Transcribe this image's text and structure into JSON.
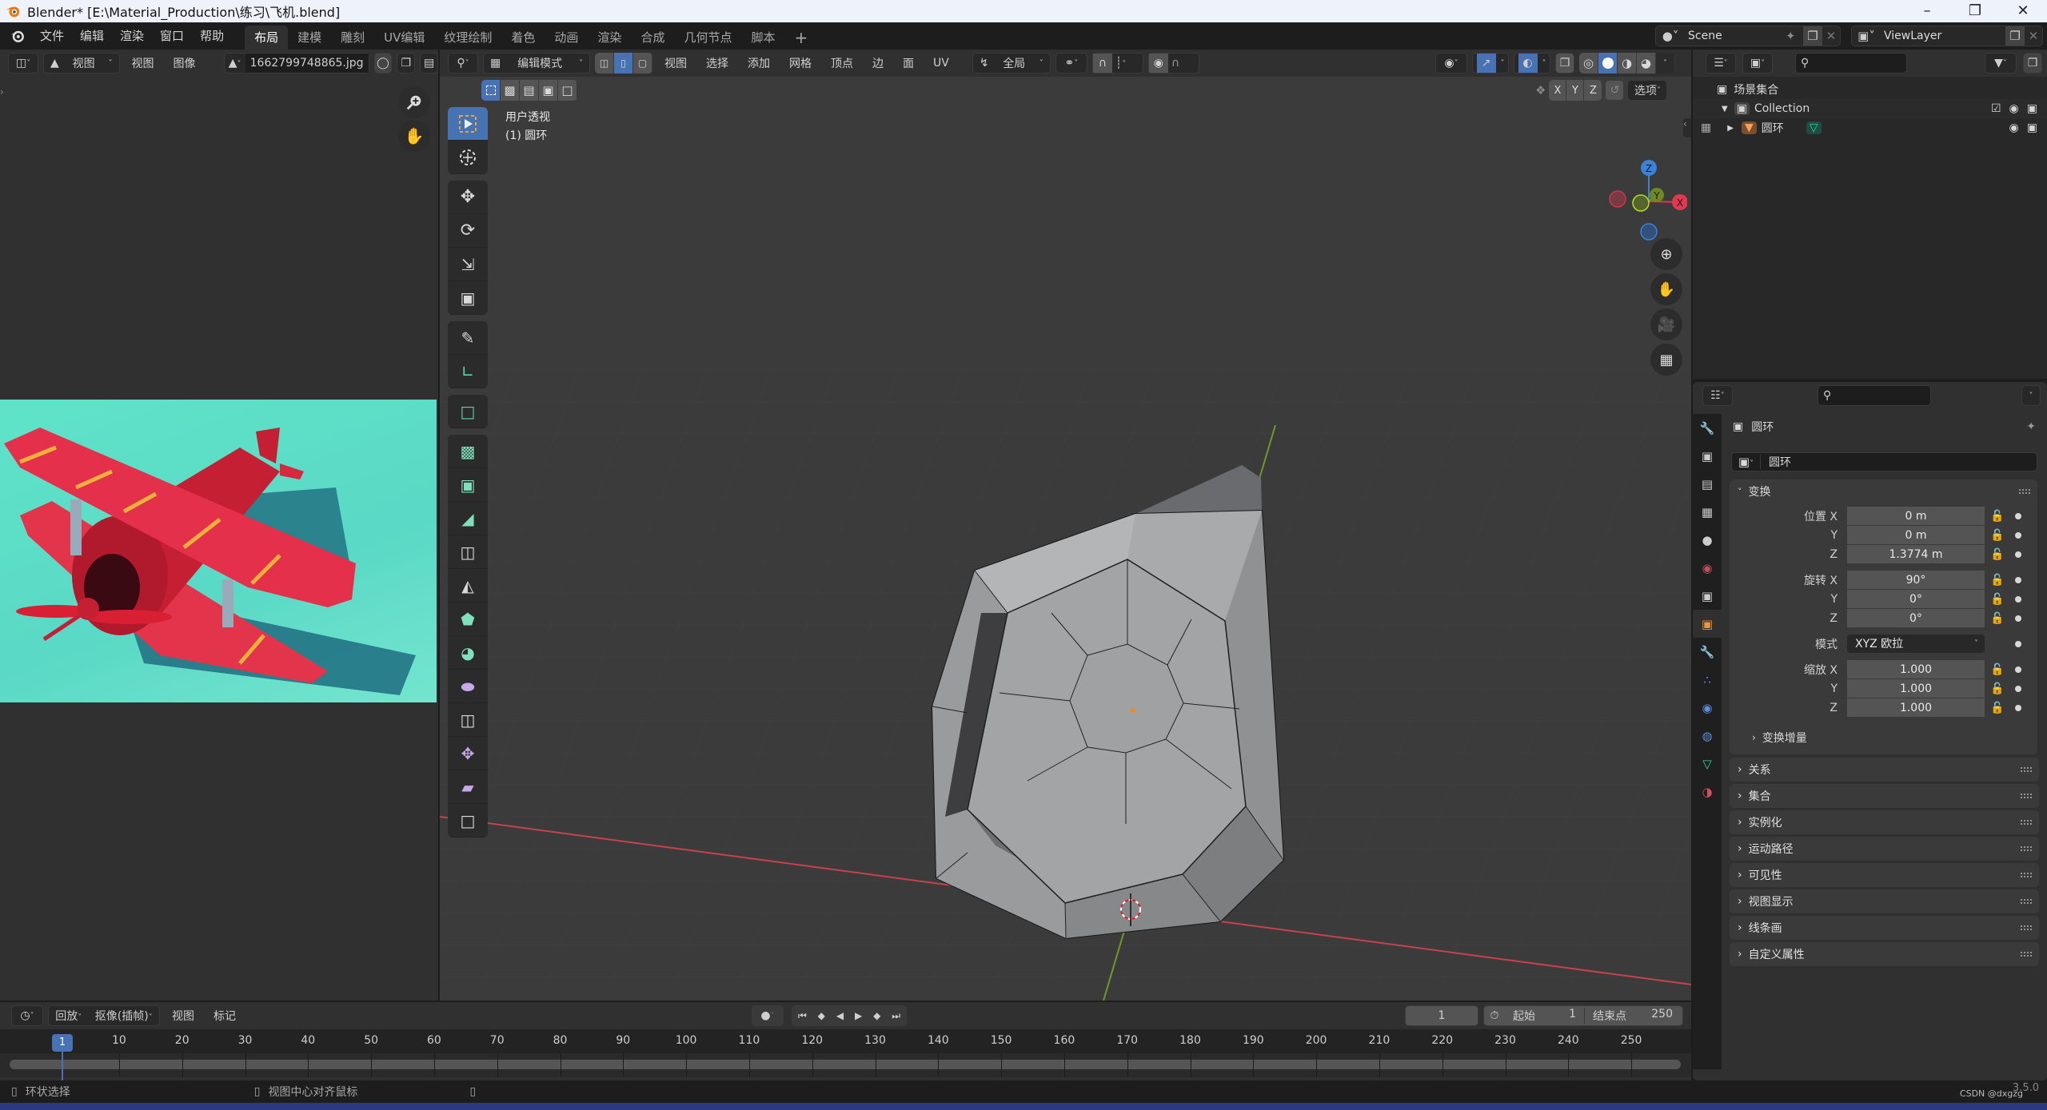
{
  "window": {
    "title": "Blender* [E:\\Material_Production\\练习\\飞机.blend]",
    "controls": [
      "minimize",
      "maximize",
      "close"
    ]
  },
  "top_menu": {
    "items": [
      "文件",
      "编辑",
      "渲染",
      "窗口",
      "帮助"
    ],
    "workspaces": [
      {
        "label": "布局",
        "active": true
      },
      {
        "label": "建模",
        "active": false
      },
      {
        "label": "雕刻",
        "active": false
      },
      {
        "label": "UV编辑",
        "active": false
      },
      {
        "label": "纹理绘制",
        "active": false
      },
      {
        "label": "着色",
        "active": false
      },
      {
        "label": "动画",
        "active": false
      },
      {
        "label": "渲染",
        "active": false
      },
      {
        "label": "合成",
        "active": false
      },
      {
        "label": "几何节点",
        "active": false
      },
      {
        "label": "脚本",
        "active": false
      }
    ],
    "add_workspace": "+",
    "scene": "Scene",
    "view_layer": "ViewLayer"
  },
  "image_editor": {
    "mode": "视图",
    "menus": [
      "视图",
      "图像"
    ],
    "image_name": "1662799748865.jpg",
    "image_subject": "red biplane on teal background"
  },
  "viewport": {
    "mode": "编辑模式",
    "select_mode_active": "edge",
    "menus": [
      "视图",
      "选择",
      "添加",
      "网格",
      "顶点",
      "边",
      "面",
      "UV"
    ],
    "transform_orientation": "全局",
    "view_name": "用户透视",
    "object_info": "(1) 圆环",
    "axis_labels": [
      "X",
      "Y",
      "Z"
    ],
    "options_label": "选项",
    "gizmo": {
      "x": "X",
      "y": "Y",
      "z": "Z"
    },
    "colors": {
      "background": "#3b3b3b",
      "x_axis": "#c6424e",
      "y_axis": "#6d9a2c",
      "accent": "#4772b3"
    },
    "tools": [
      "select-box",
      "cursor",
      "move",
      "rotate",
      "scale",
      "transform",
      "annotate",
      "measure",
      "add-cube",
      "extrude",
      "inset",
      "bevel",
      "loop-cut",
      "knife",
      "poly-build",
      "spin",
      "smooth",
      "edge-slide",
      "shrink-fatten",
      "shear",
      "rip-region"
    ]
  },
  "outliner": {
    "root": "场景集合",
    "collection": "Collection",
    "object": "圆环"
  },
  "properties": {
    "object_name": "圆环",
    "datablock_name": "圆环",
    "transform_section": "变换",
    "location": {
      "label": "位置",
      "x": "0 m",
      "y": "0 m",
      "z": "1.3774 m"
    },
    "rotation": {
      "label": "旋转",
      "x": "90°",
      "y": "0°",
      "z": "0°"
    },
    "rotation_mode_label": "模式",
    "rotation_mode": "XYZ 欧拉",
    "scale": {
      "label": "缩放",
      "x": "1.000",
      "y": "1.000",
      "z": "1.000"
    },
    "axis": {
      "x": "X",
      "y": "Y",
      "z": "Z"
    },
    "delta_transform": "变换增量",
    "sections": [
      "关系",
      "集合",
      "实例化",
      "运动路径",
      "可见性",
      "视图显示",
      "线条画",
      "自定义属性"
    ]
  },
  "timeline": {
    "menus": [
      "回放",
      "抠像(插帧)",
      "视图",
      "标记"
    ],
    "current_frame": "1",
    "start_label": "起始",
    "start": "1",
    "end_label": "结束点",
    "end": "250",
    "ruler_ticks": [
      "10",
      "20",
      "30",
      "40",
      "50",
      "60",
      "70",
      "80",
      "90",
      "100",
      "110",
      "120",
      "130",
      "140",
      "150",
      "160",
      "170",
      "180",
      "190",
      "200",
      "210",
      "220",
      "230",
      "240",
      "250"
    ],
    "playhead_label": "1"
  },
  "status_bar": {
    "left_mouse": "环状选择",
    "middle_mouse": "视图中心对齐鼠标",
    "right_mouse": "",
    "version": "3.5.0",
    "watermark": "CSDN @dxgzg"
  }
}
